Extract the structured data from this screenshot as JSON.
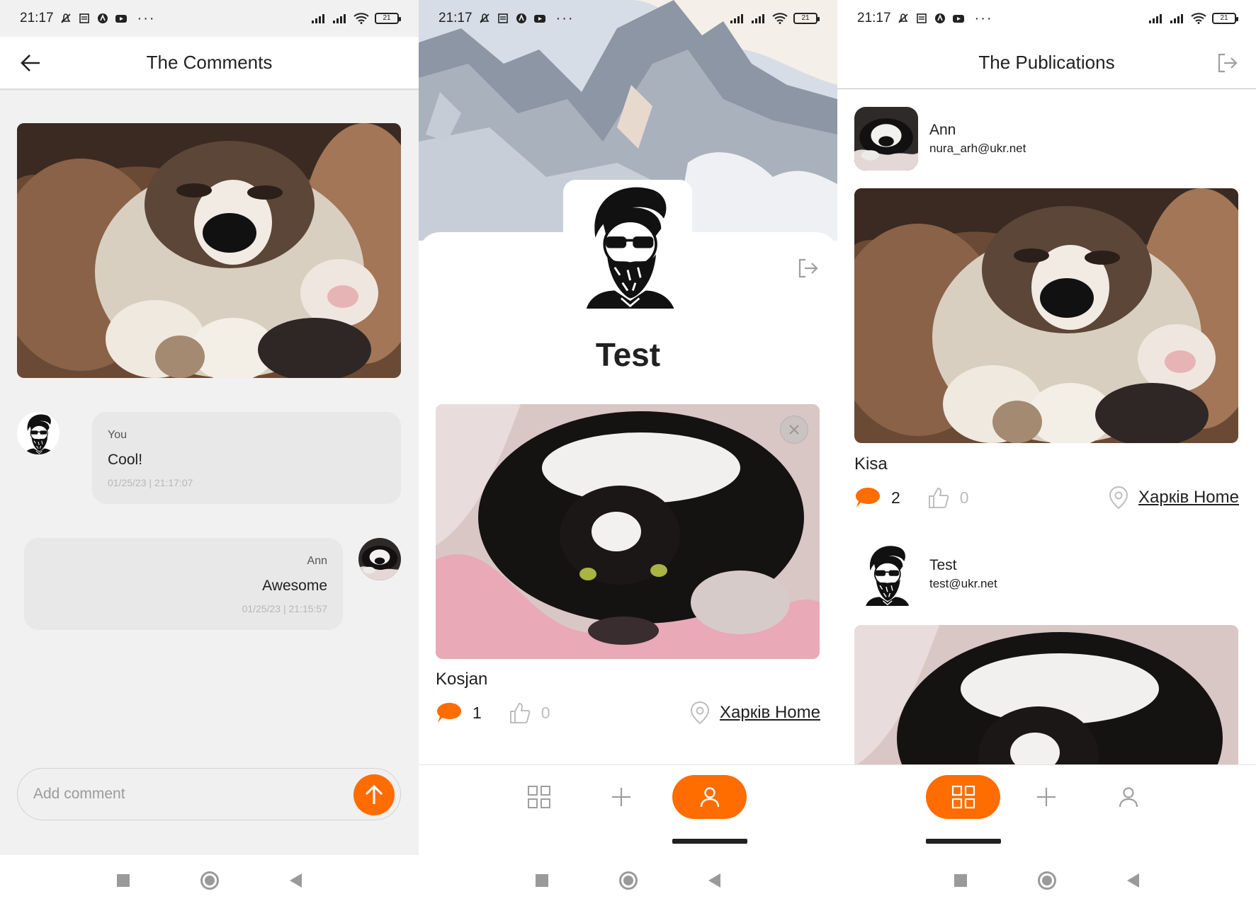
{
  "status_bar": {
    "time": "21:17",
    "battery": "21",
    "more": "···"
  },
  "screen1": {
    "title": "The Comments",
    "comments": [
      {
        "author": "You",
        "text": "Cool!",
        "time": "01/25/23 | 21:17:07"
      },
      {
        "author": "Ann",
        "text": "Awesome",
        "time": "01/25/23 | 21:15:57"
      }
    ],
    "input": {
      "placeholder": "Add comment",
      "value": ""
    }
  },
  "screen2": {
    "profile_name": "Test",
    "post": {
      "title": "Kosjan",
      "comments": "1",
      "likes": "0",
      "location": "Харків Home"
    }
  },
  "screen3": {
    "title": "The Publications",
    "users": [
      {
        "name": "Ann",
        "email": "nura_arh@ukr.net"
      },
      {
        "name": "Test",
        "email": "test@ukr.net"
      }
    ],
    "post": {
      "title": "Kisa",
      "comments": "2",
      "likes": "0",
      "location": "Харків Home"
    }
  },
  "colors": {
    "accent": "#ff6c00",
    "text": "#212121",
    "muted": "#bdbdbd",
    "bubble": "#e8e8e8"
  },
  "icons": [
    "back-arrow-icon",
    "logout-icon",
    "send-arrow-icon",
    "comment-icon",
    "like-icon",
    "map-pin-icon",
    "grid-icon",
    "plus-icon",
    "user-icon"
  ]
}
